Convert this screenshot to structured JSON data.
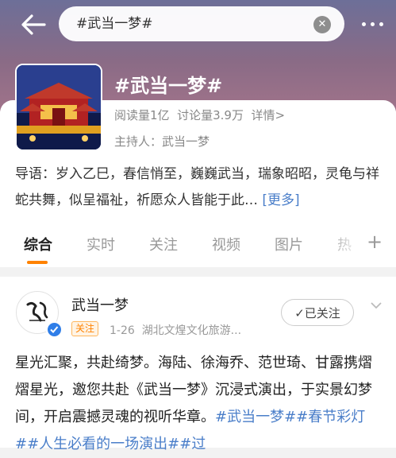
{
  "search": {
    "value": "#武当一梦#"
  },
  "topic": {
    "title": "#武当一梦#",
    "reads": "阅读量1亿",
    "discussions": "讨论量3.9万",
    "detail_link": "详情>",
    "host": "主持人：武当一梦",
    "intro": "导语：岁入乙巳，春信悄至，巍巍武当，瑞象昭昭，灵龟与祥蛇共舞，似呈福祉，祈愿众人皆能于此…",
    "intro_more": "[更多]"
  },
  "tabs": [
    "综合",
    "实时",
    "关注",
    "视频",
    "图片",
    "热"
  ],
  "post": {
    "author": "武当一梦",
    "follow_tag": "关注",
    "date": "1-26",
    "source": "湖北文煌文化旅游...",
    "followed_label": "已关注",
    "text_plain": "星光汇聚，共赴绮梦。海陆、徐海乔、范世琦、甘露携熠熠星光，邀您共赴《武当一梦》沉浸式演出，于实景幻梦间，开启震撼灵魂的视听华章。",
    "hashtags": "#武当一梦##春节彩灯##人生必看的一场演出##过"
  },
  "colors": {
    "accent": "#ff8200",
    "link": "#4a7ec9",
    "verified": "#2f7ee8"
  },
  "icons": [
    "back-arrow-icon",
    "clear-icon",
    "more-icon",
    "plus-icon",
    "verified-icon",
    "check-icon",
    "chevron-down-icon"
  ]
}
